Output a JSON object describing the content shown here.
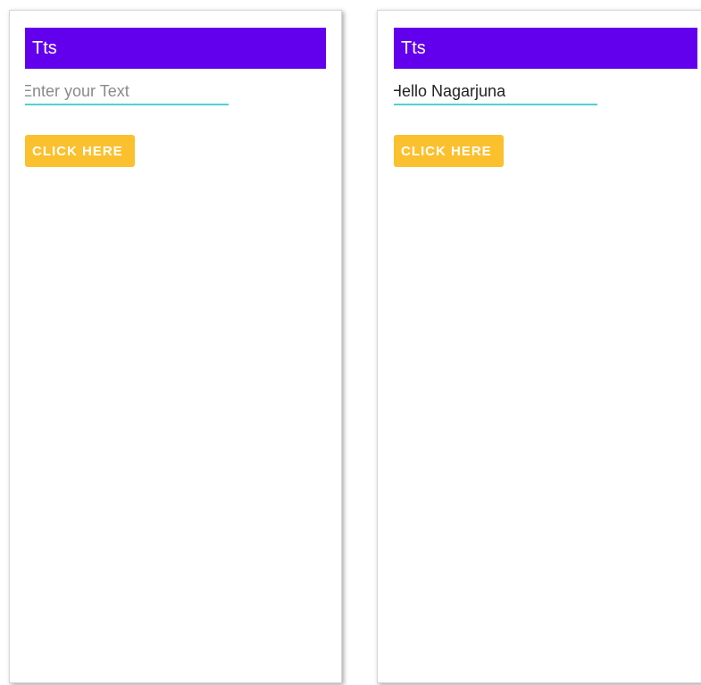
{
  "screens": [
    {
      "title": "Tts",
      "input_value": "",
      "input_placeholder": "Enter your Text",
      "button_label": "CLICK HERE"
    },
    {
      "title": "Tts",
      "input_value": "Hello Nagarjuna",
      "input_placeholder": "Enter your Text",
      "button_label": "CLICK HERE"
    }
  ],
  "colors": {
    "app_bar": "#6200ee",
    "button": "#fbc02d",
    "input_underline": "#4fd1d6"
  }
}
